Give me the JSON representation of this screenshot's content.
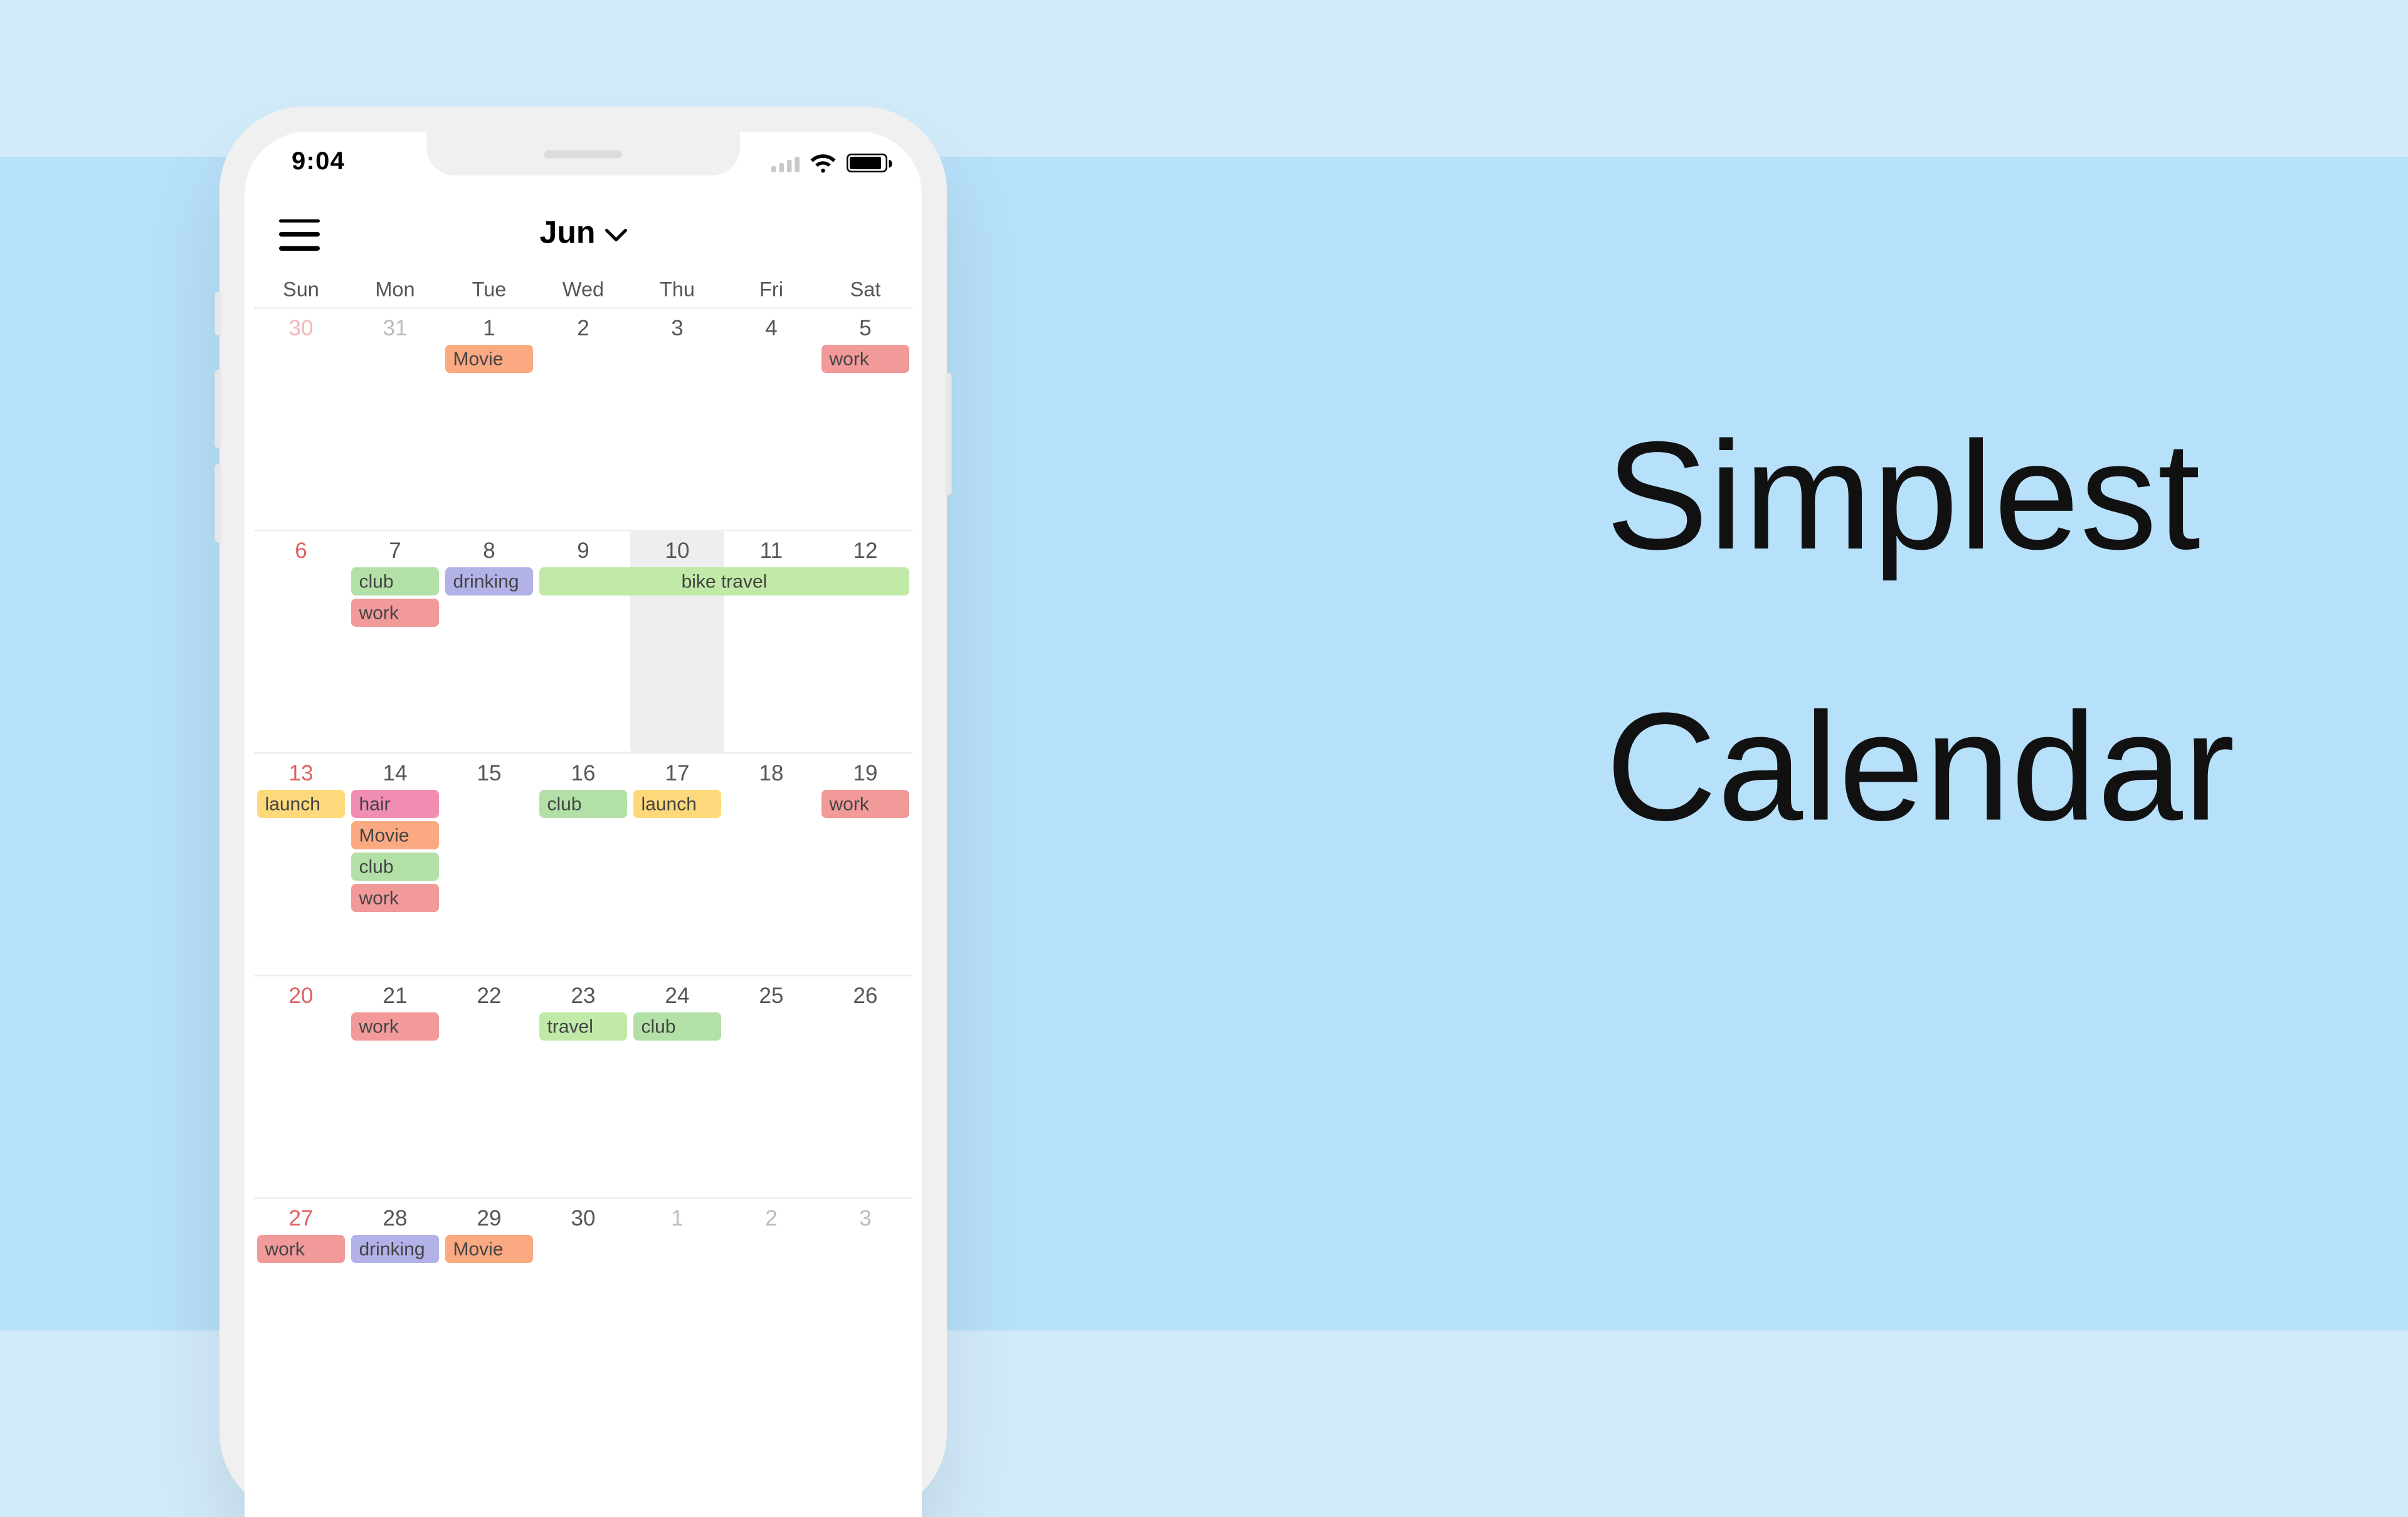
{
  "promo": {
    "line1": "Simplest",
    "line2": "Calendar"
  },
  "status": {
    "time": "9:04"
  },
  "header": {
    "month": "Jun"
  },
  "weekdays": [
    "Sun",
    "Mon",
    "Tue",
    "Wed",
    "Thu",
    "Fri",
    "Sat"
  ],
  "weeks": [
    {
      "height": 142,
      "days": [
        {
          "n": "30",
          "dim": true,
          "sun": true
        },
        {
          "n": "31",
          "dim": true
        },
        {
          "n": "1"
        },
        {
          "n": "2"
        },
        {
          "n": "3"
        },
        {
          "n": "4"
        },
        {
          "n": "5"
        }
      ],
      "rows": [
        [
          null,
          null,
          {
            "label": "Movie",
            "color": "orange"
          },
          null,
          null,
          null,
          {
            "label": "work",
            "color": "red"
          }
        ]
      ]
    },
    {
      "height": 142,
      "highlight": 4,
      "days": [
        {
          "n": "6",
          "sun": true
        },
        {
          "n": "7"
        },
        {
          "n": "8"
        },
        {
          "n": "9"
        },
        {
          "n": "10"
        },
        {
          "n": "11"
        },
        {
          "n": "12"
        }
      ],
      "rows": [
        [
          null,
          {
            "label": "club",
            "color": "green"
          },
          {
            "label": "drinking",
            "color": "purple"
          },
          {
            "label": "bike travel",
            "color": "lgreen",
            "span": 4,
            "center": true
          }
        ],
        [
          null,
          {
            "label": "work",
            "color": "red"
          },
          null,
          null,
          null,
          null,
          null
        ]
      ]
    },
    {
      "height": 142,
      "days": [
        {
          "n": "13",
          "sun": true
        },
        {
          "n": "14"
        },
        {
          "n": "15"
        },
        {
          "n": "16"
        },
        {
          "n": "17"
        },
        {
          "n": "18"
        },
        {
          "n": "19"
        }
      ],
      "rows": [
        [
          {
            "label": "launch",
            "color": "yellow"
          },
          {
            "label": "hair",
            "color": "pink"
          },
          null,
          {
            "label": "club",
            "color": "green"
          },
          {
            "label": "launch",
            "color": "yellow"
          },
          null,
          {
            "label": "work",
            "color": "red"
          }
        ],
        [
          null,
          {
            "label": "Movie",
            "color": "orange"
          },
          null,
          null,
          null,
          null,
          null
        ],
        [
          null,
          {
            "label": "club",
            "color": "green"
          },
          null,
          null,
          null,
          null,
          null
        ],
        [
          null,
          {
            "label": "work",
            "color": "red"
          },
          null,
          null,
          null,
          null,
          null
        ]
      ]
    },
    {
      "height": 142,
      "days": [
        {
          "n": "20",
          "sun": true
        },
        {
          "n": "21"
        },
        {
          "n": "22"
        },
        {
          "n": "23"
        },
        {
          "n": "24"
        },
        {
          "n": "25"
        },
        {
          "n": "26"
        }
      ],
      "rows": [
        [
          null,
          {
            "label": "work",
            "color": "red"
          },
          null,
          {
            "label": "travel",
            "color": "lgreen"
          },
          {
            "label": "club",
            "color": "green"
          },
          null,
          null
        ]
      ]
    },
    {
      "height": 100,
      "days": [
        {
          "n": "27",
          "sun": true
        },
        {
          "n": "28"
        },
        {
          "n": "29"
        },
        {
          "n": "30"
        },
        {
          "n": "1",
          "dim": true
        },
        {
          "n": "2",
          "dim": true
        },
        {
          "n": "3",
          "dim": true
        }
      ],
      "rows": [
        [
          {
            "label": "work",
            "color": "red"
          },
          {
            "label": "drinking",
            "color": "purple"
          },
          {
            "label": "Movie",
            "color": "orange"
          },
          null,
          null,
          null,
          null
        ]
      ]
    }
  ]
}
